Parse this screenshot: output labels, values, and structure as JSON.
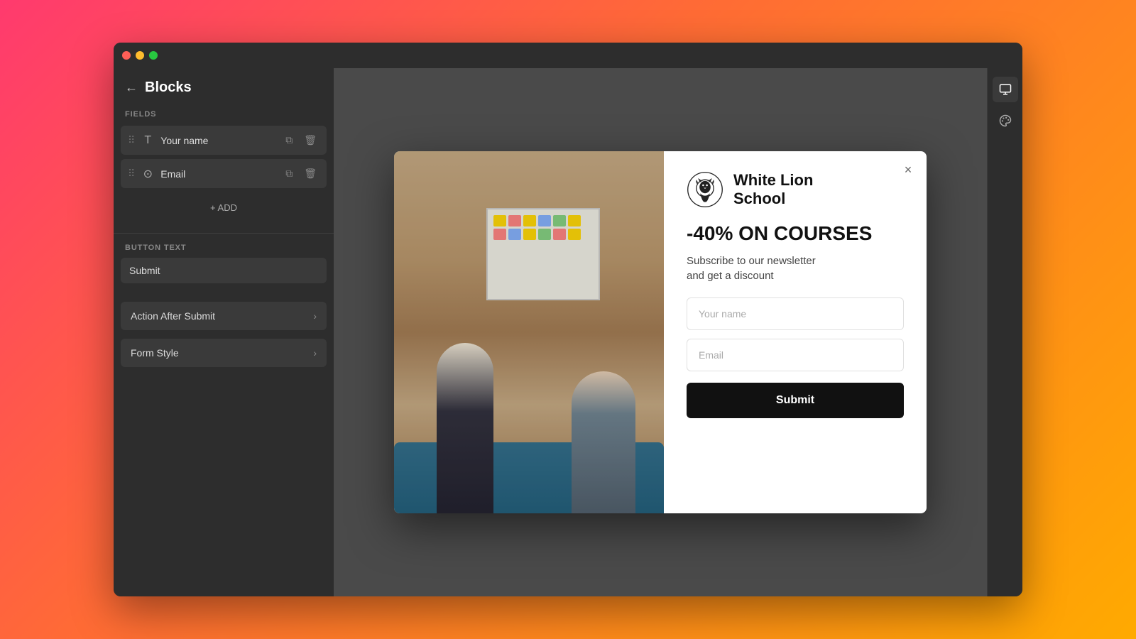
{
  "browser": {
    "traffic_lights": [
      "close",
      "minimize",
      "maximize"
    ]
  },
  "sidebar": {
    "back_label": "←",
    "title": "Blocks",
    "fields_section_label": "FIELDS",
    "fields": [
      {
        "id": "your-name",
        "icon": "T",
        "icon_type": "text",
        "name": "Your name"
      },
      {
        "id": "email",
        "icon": "⊙",
        "icon_type": "email",
        "name": "Email"
      }
    ],
    "add_label": "+ ADD",
    "button_text_label": "BUTTON TEXT",
    "button_text_value": "Submit",
    "action_after_submit_label": "Action After Submit",
    "form_style_label": "Form Style"
  },
  "modal": {
    "close_label": "×",
    "logo": {
      "school_name_line1": "White Lion",
      "school_name_line2": "School",
      "full_name": "White Lion School"
    },
    "headline": "-40% ON COURSES",
    "subtext_line1": "Subscribe to our newsletter",
    "subtext_line2": "and get a discount",
    "form": {
      "name_placeholder": "Your name",
      "email_placeholder": "Email",
      "submit_label": "Submit"
    }
  },
  "right_sidebar": {
    "desktop_icon": "🖥",
    "paint_icon": "🎨"
  }
}
